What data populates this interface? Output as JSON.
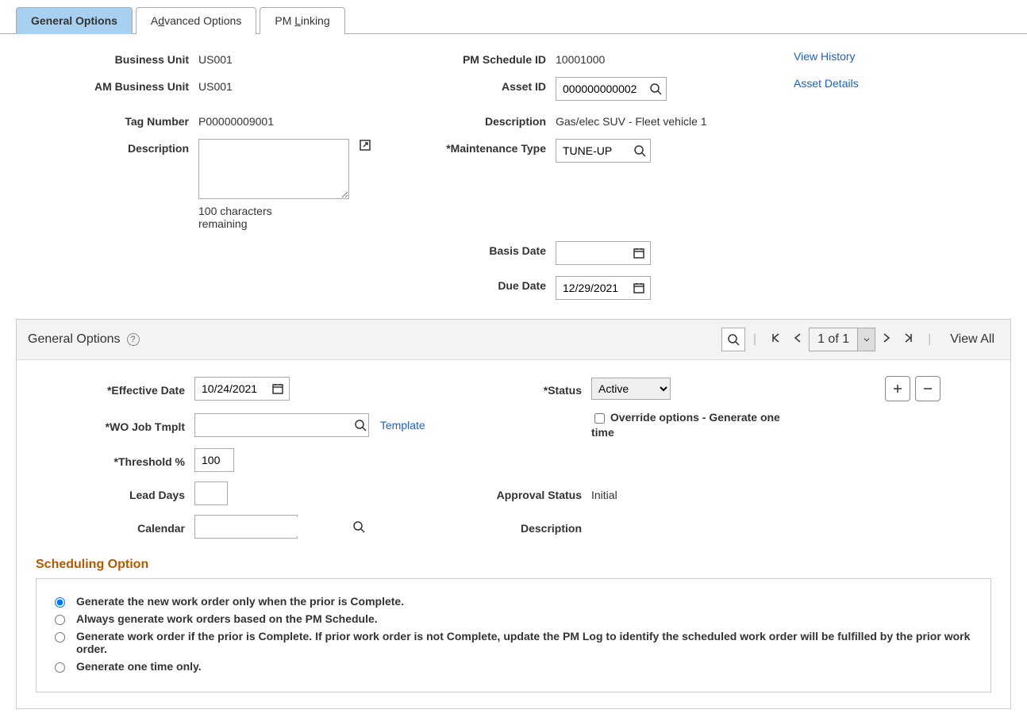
{
  "tabs": {
    "general": "General Options",
    "advanced_prefix": "A",
    "advanced_uline": "d",
    "advanced_suffix": "vanced Options",
    "linking_prefix": "PM ",
    "linking_uline": "L",
    "linking_suffix": "inking"
  },
  "header": {
    "bu_label": "Business Unit",
    "bu_value": "US001",
    "am_bu_label": "AM Business Unit",
    "am_bu_value": "US001",
    "tag_label": "Tag Number",
    "tag_value": "P00000009001",
    "desc_label": "Description",
    "desc_value": "",
    "char_remaining": "100 characters remaining",
    "pm_id_label": "PM Schedule ID",
    "pm_id_value": "10001000",
    "asset_id_label": "Asset ID",
    "asset_id_value": "000000000002",
    "desc2_label": "Description",
    "desc2_value": "Gas/elec SUV - Fleet vehicle 1",
    "maint_label": "*Maintenance Type",
    "maint_value": "TUNE-UP",
    "basis_label": "Basis Date",
    "basis_value": "",
    "due_label": "Due Date",
    "due_value": "12/29/2021",
    "link_history": "View History",
    "link_asset": "Asset Details"
  },
  "section": {
    "title": "General Options",
    "counter": "1 of 1",
    "view_all": "View All"
  },
  "form": {
    "eff_label": "*Effective Date",
    "eff_value": "10/24/2021",
    "status_label": "*Status",
    "status_value": "Active",
    "job_label": "*WO Job Tmplt",
    "job_value": "",
    "template_link": "Template",
    "override_label": "Override options - Generate one time",
    "thresh_label": "*Threshold %",
    "thresh_value": "100",
    "lead_label": "Lead Days",
    "lead_value": "",
    "appr_label": "Approval Status",
    "appr_value": "Initial",
    "cal_label": "Calendar",
    "cal_value": "",
    "desc3_label": "Description"
  },
  "sched": {
    "heading": "Scheduling Option",
    "opt1": "Generate the new work order only when the prior is Complete.",
    "opt2": "Always generate work orders based on the PM Schedule.",
    "opt3": "Generate work order if the prior is Complete. If prior work order is not Complete, update the PM Log to identify the scheduled work order will be fulfilled by the prior work order.",
    "opt4": "Generate one time only."
  }
}
